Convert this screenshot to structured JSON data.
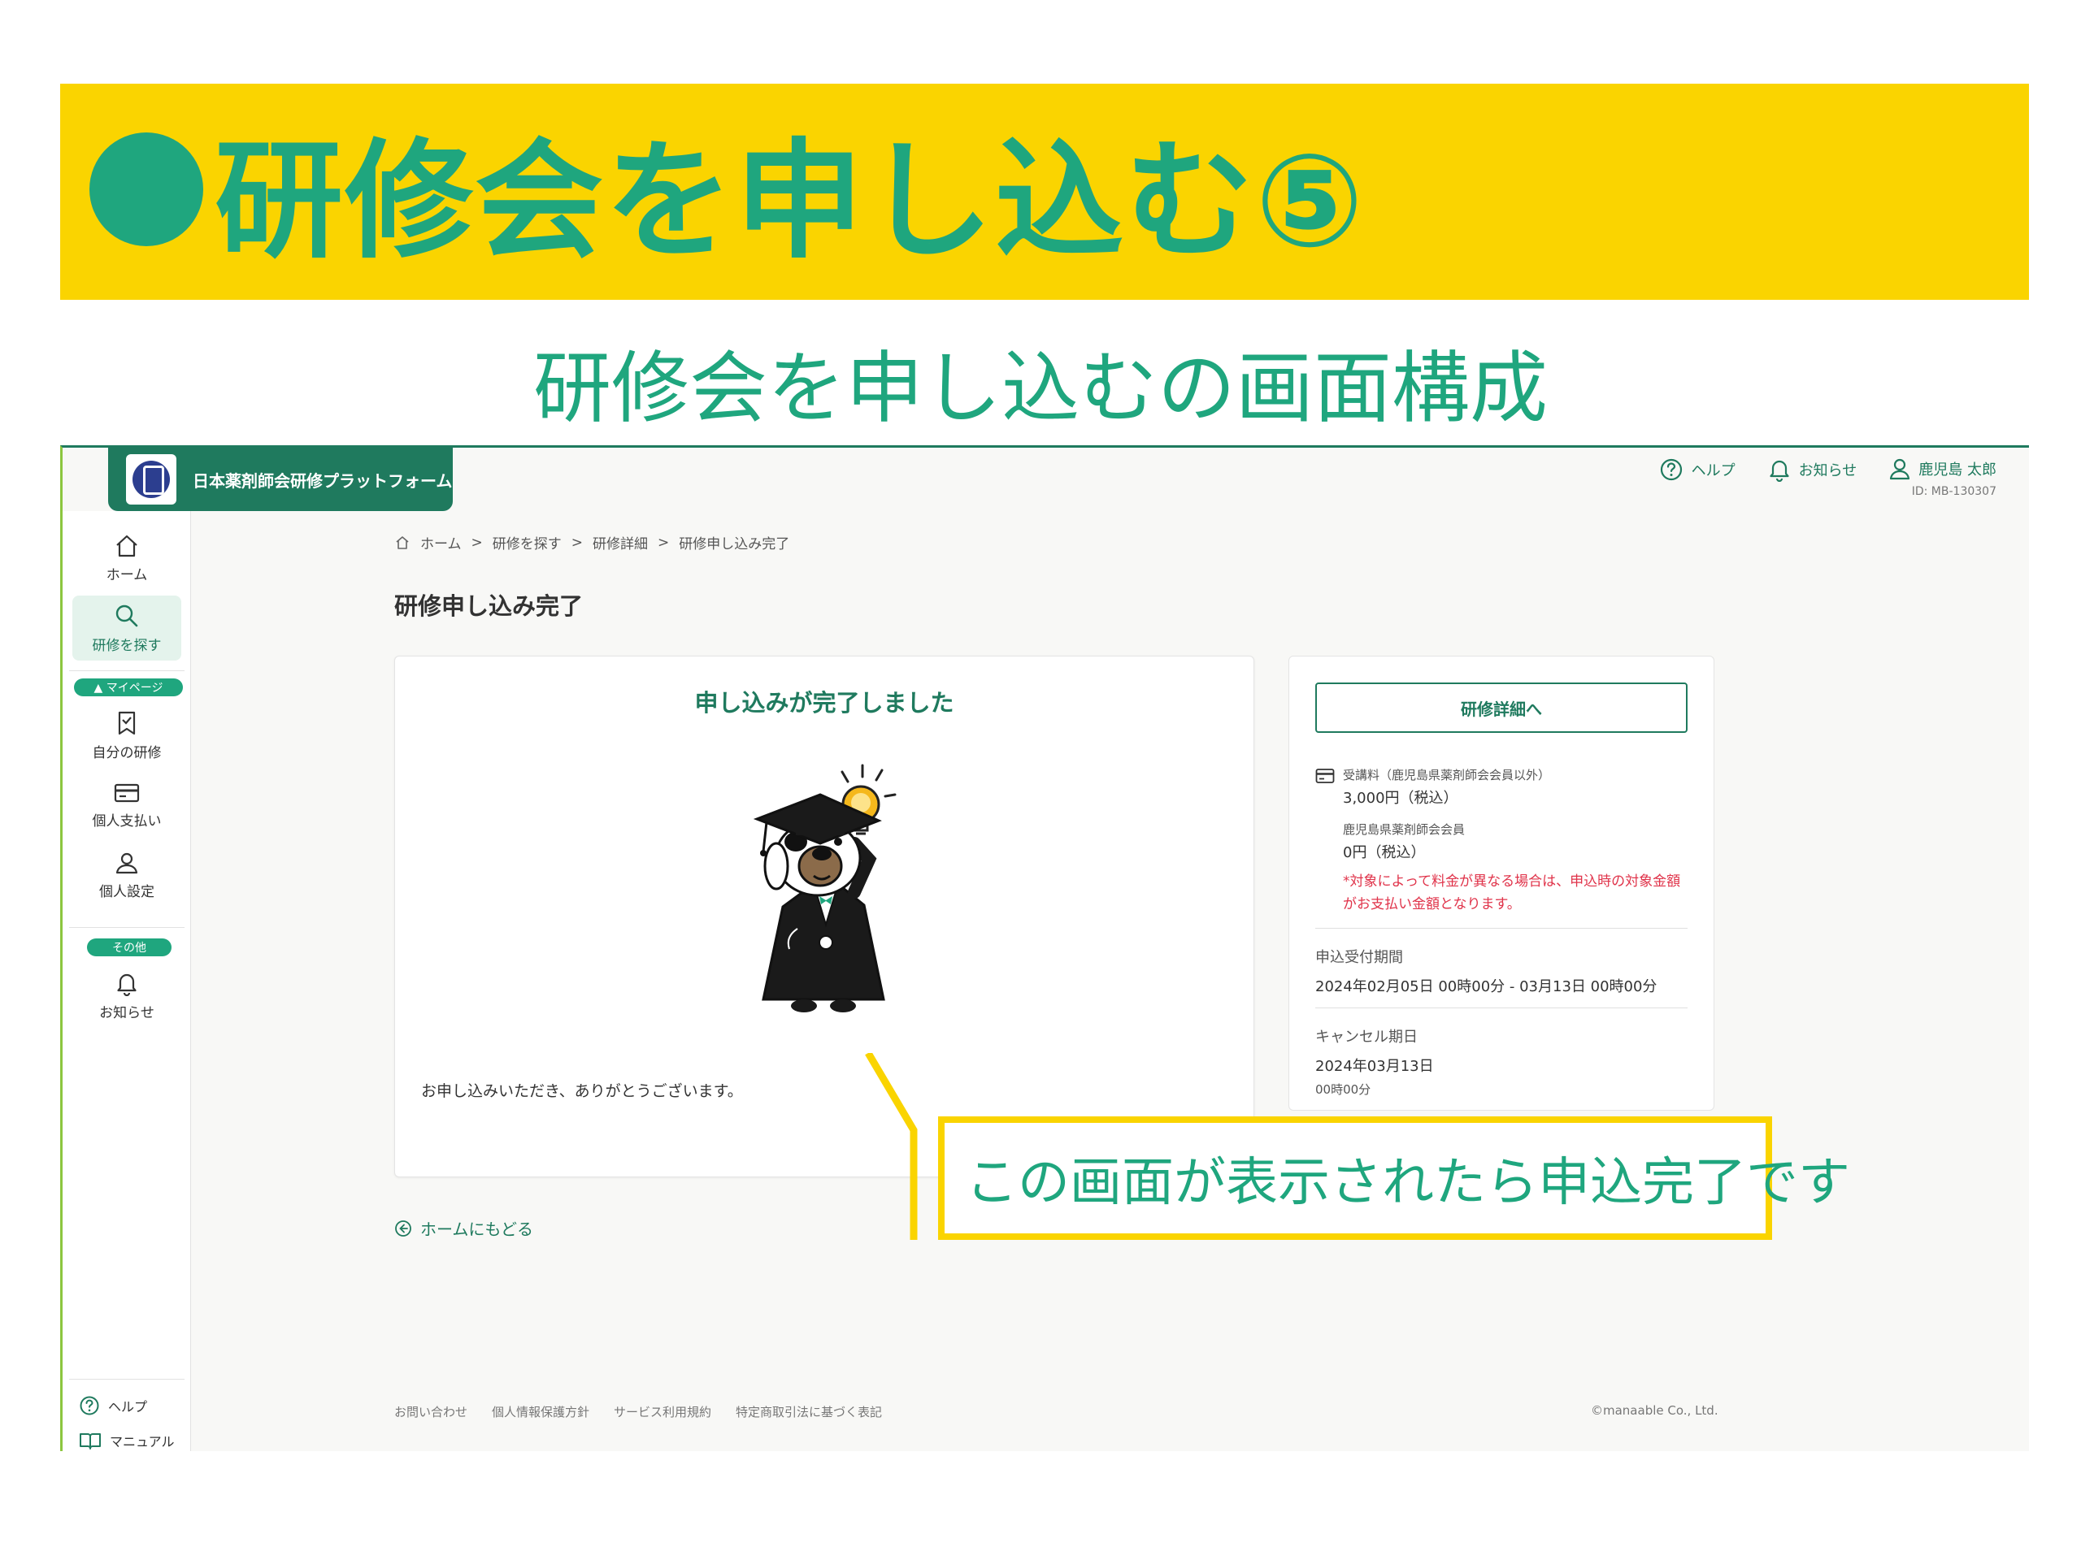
{
  "slide": {
    "title": "研修会を申し込む⑤",
    "subtitle": "研修会を申し込むの画面構成"
  },
  "header": {
    "logo_text": "日本薬剤師会研修プラットフォーム",
    "help_label": "ヘルプ",
    "news_label": "お知らせ",
    "user_name": "鹿児島 太郎",
    "user_id": "ID: MB-130307"
  },
  "sidebar": {
    "home": "ホーム",
    "search": "研修を探す",
    "mypage_section": "▲ マイページ",
    "my_training": "自分の研修",
    "payment": "個人支払い",
    "settings": "個人設定",
    "other_section": "その他",
    "news": "お知らせ",
    "help": "ヘルプ",
    "manual": "マニュアル"
  },
  "breadcrumb": {
    "items": [
      "ホーム",
      "研修を探す",
      "研修詳細",
      "研修申し込み完了"
    ],
    "separator": ">"
  },
  "page_title": "研修申し込み完了",
  "main_card": {
    "heading": "申し込みが完了しました",
    "message": "お申し込みいただき、ありがとうございます。"
  },
  "back_link": "ホームにもどる",
  "side_card": {
    "detail_button": "研修詳細へ",
    "fee_label_1": "受講料（鹿児島県薬剤師会会員以外）",
    "fee_value_1": "3,000円（税込）",
    "fee_label_2": "鹿児島県薬剤師会会員",
    "fee_value_2": "0円（税込）",
    "fee_note": "*対象によって料金が異なる場合は、申込時の対象金額がお支払い金額となります。",
    "period_label": "申込受付期間",
    "period_value": "2024年02月05日 00時00分 - 03月13日 00時00分",
    "cancel_label": "キャンセル期日",
    "cancel_date": "2024年03月13日",
    "cancel_time": "00時00分"
  },
  "footer": {
    "links": [
      "お問い合わせ",
      "個人情報保護方針",
      "サービス利用規約",
      "特定商取引法に基づく表記"
    ],
    "copyright": "©manaable Co., Ltd."
  },
  "callout": {
    "text": "この画面が表示されたら申込完了です"
  },
  "colors": {
    "brand_green": "#1fa67e",
    "dark_green": "#1f7a5e",
    "banner_yellow": "#fad400",
    "note_red": "#e0334a"
  }
}
